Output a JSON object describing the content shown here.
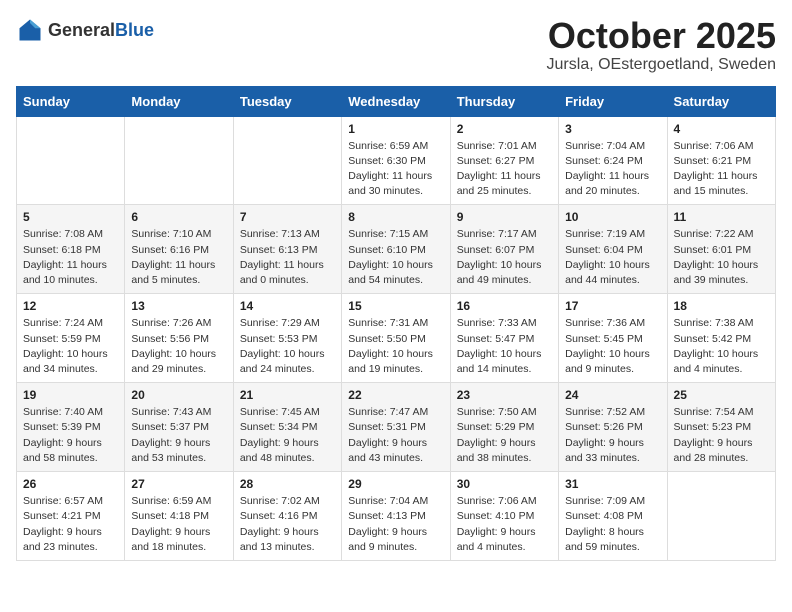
{
  "logo": {
    "general": "General",
    "blue": "Blue"
  },
  "header": {
    "month": "October 2025",
    "location": "Jursla, OEstergoetland, Sweden"
  },
  "weekdays": [
    "Sunday",
    "Monday",
    "Tuesday",
    "Wednesday",
    "Thursday",
    "Friday",
    "Saturday"
  ],
  "weeks": [
    [
      {
        "day": "",
        "info": ""
      },
      {
        "day": "",
        "info": ""
      },
      {
        "day": "",
        "info": ""
      },
      {
        "day": "1",
        "info": "Sunrise: 6:59 AM\nSunset: 6:30 PM\nDaylight: 11 hours\nand 30 minutes."
      },
      {
        "day": "2",
        "info": "Sunrise: 7:01 AM\nSunset: 6:27 PM\nDaylight: 11 hours\nand 25 minutes."
      },
      {
        "day": "3",
        "info": "Sunrise: 7:04 AM\nSunset: 6:24 PM\nDaylight: 11 hours\nand 20 minutes."
      },
      {
        "day": "4",
        "info": "Sunrise: 7:06 AM\nSunset: 6:21 PM\nDaylight: 11 hours\nand 15 minutes."
      }
    ],
    [
      {
        "day": "5",
        "info": "Sunrise: 7:08 AM\nSunset: 6:18 PM\nDaylight: 11 hours\nand 10 minutes."
      },
      {
        "day": "6",
        "info": "Sunrise: 7:10 AM\nSunset: 6:16 PM\nDaylight: 11 hours\nand 5 minutes."
      },
      {
        "day": "7",
        "info": "Sunrise: 7:13 AM\nSunset: 6:13 PM\nDaylight: 11 hours\nand 0 minutes."
      },
      {
        "day": "8",
        "info": "Sunrise: 7:15 AM\nSunset: 6:10 PM\nDaylight: 10 hours\nand 54 minutes."
      },
      {
        "day": "9",
        "info": "Sunrise: 7:17 AM\nSunset: 6:07 PM\nDaylight: 10 hours\nand 49 minutes."
      },
      {
        "day": "10",
        "info": "Sunrise: 7:19 AM\nSunset: 6:04 PM\nDaylight: 10 hours\nand 44 minutes."
      },
      {
        "day": "11",
        "info": "Sunrise: 7:22 AM\nSunset: 6:01 PM\nDaylight: 10 hours\nand 39 minutes."
      }
    ],
    [
      {
        "day": "12",
        "info": "Sunrise: 7:24 AM\nSunset: 5:59 PM\nDaylight: 10 hours\nand 34 minutes."
      },
      {
        "day": "13",
        "info": "Sunrise: 7:26 AM\nSunset: 5:56 PM\nDaylight: 10 hours\nand 29 minutes."
      },
      {
        "day": "14",
        "info": "Sunrise: 7:29 AM\nSunset: 5:53 PM\nDaylight: 10 hours\nand 24 minutes."
      },
      {
        "day": "15",
        "info": "Sunrise: 7:31 AM\nSunset: 5:50 PM\nDaylight: 10 hours\nand 19 minutes."
      },
      {
        "day": "16",
        "info": "Sunrise: 7:33 AM\nSunset: 5:47 PM\nDaylight: 10 hours\nand 14 minutes."
      },
      {
        "day": "17",
        "info": "Sunrise: 7:36 AM\nSunset: 5:45 PM\nDaylight: 10 hours\nand 9 minutes."
      },
      {
        "day": "18",
        "info": "Sunrise: 7:38 AM\nSunset: 5:42 PM\nDaylight: 10 hours\nand 4 minutes."
      }
    ],
    [
      {
        "day": "19",
        "info": "Sunrise: 7:40 AM\nSunset: 5:39 PM\nDaylight: 9 hours\nand 58 minutes."
      },
      {
        "day": "20",
        "info": "Sunrise: 7:43 AM\nSunset: 5:37 PM\nDaylight: 9 hours\nand 53 minutes."
      },
      {
        "day": "21",
        "info": "Sunrise: 7:45 AM\nSunset: 5:34 PM\nDaylight: 9 hours\nand 48 minutes."
      },
      {
        "day": "22",
        "info": "Sunrise: 7:47 AM\nSunset: 5:31 PM\nDaylight: 9 hours\nand 43 minutes."
      },
      {
        "day": "23",
        "info": "Sunrise: 7:50 AM\nSunset: 5:29 PM\nDaylight: 9 hours\nand 38 minutes."
      },
      {
        "day": "24",
        "info": "Sunrise: 7:52 AM\nSunset: 5:26 PM\nDaylight: 9 hours\nand 33 minutes."
      },
      {
        "day": "25",
        "info": "Sunrise: 7:54 AM\nSunset: 5:23 PM\nDaylight: 9 hours\nand 28 minutes."
      }
    ],
    [
      {
        "day": "26",
        "info": "Sunrise: 6:57 AM\nSunset: 4:21 PM\nDaylight: 9 hours\nand 23 minutes."
      },
      {
        "day": "27",
        "info": "Sunrise: 6:59 AM\nSunset: 4:18 PM\nDaylight: 9 hours\nand 18 minutes."
      },
      {
        "day": "28",
        "info": "Sunrise: 7:02 AM\nSunset: 4:16 PM\nDaylight: 9 hours\nand 13 minutes."
      },
      {
        "day": "29",
        "info": "Sunrise: 7:04 AM\nSunset: 4:13 PM\nDaylight: 9 hours\nand 9 minutes."
      },
      {
        "day": "30",
        "info": "Sunrise: 7:06 AM\nSunset: 4:10 PM\nDaylight: 9 hours\nand 4 minutes."
      },
      {
        "day": "31",
        "info": "Sunrise: 7:09 AM\nSunset: 4:08 PM\nDaylight: 8 hours\nand 59 minutes."
      },
      {
        "day": "",
        "info": ""
      }
    ]
  ]
}
